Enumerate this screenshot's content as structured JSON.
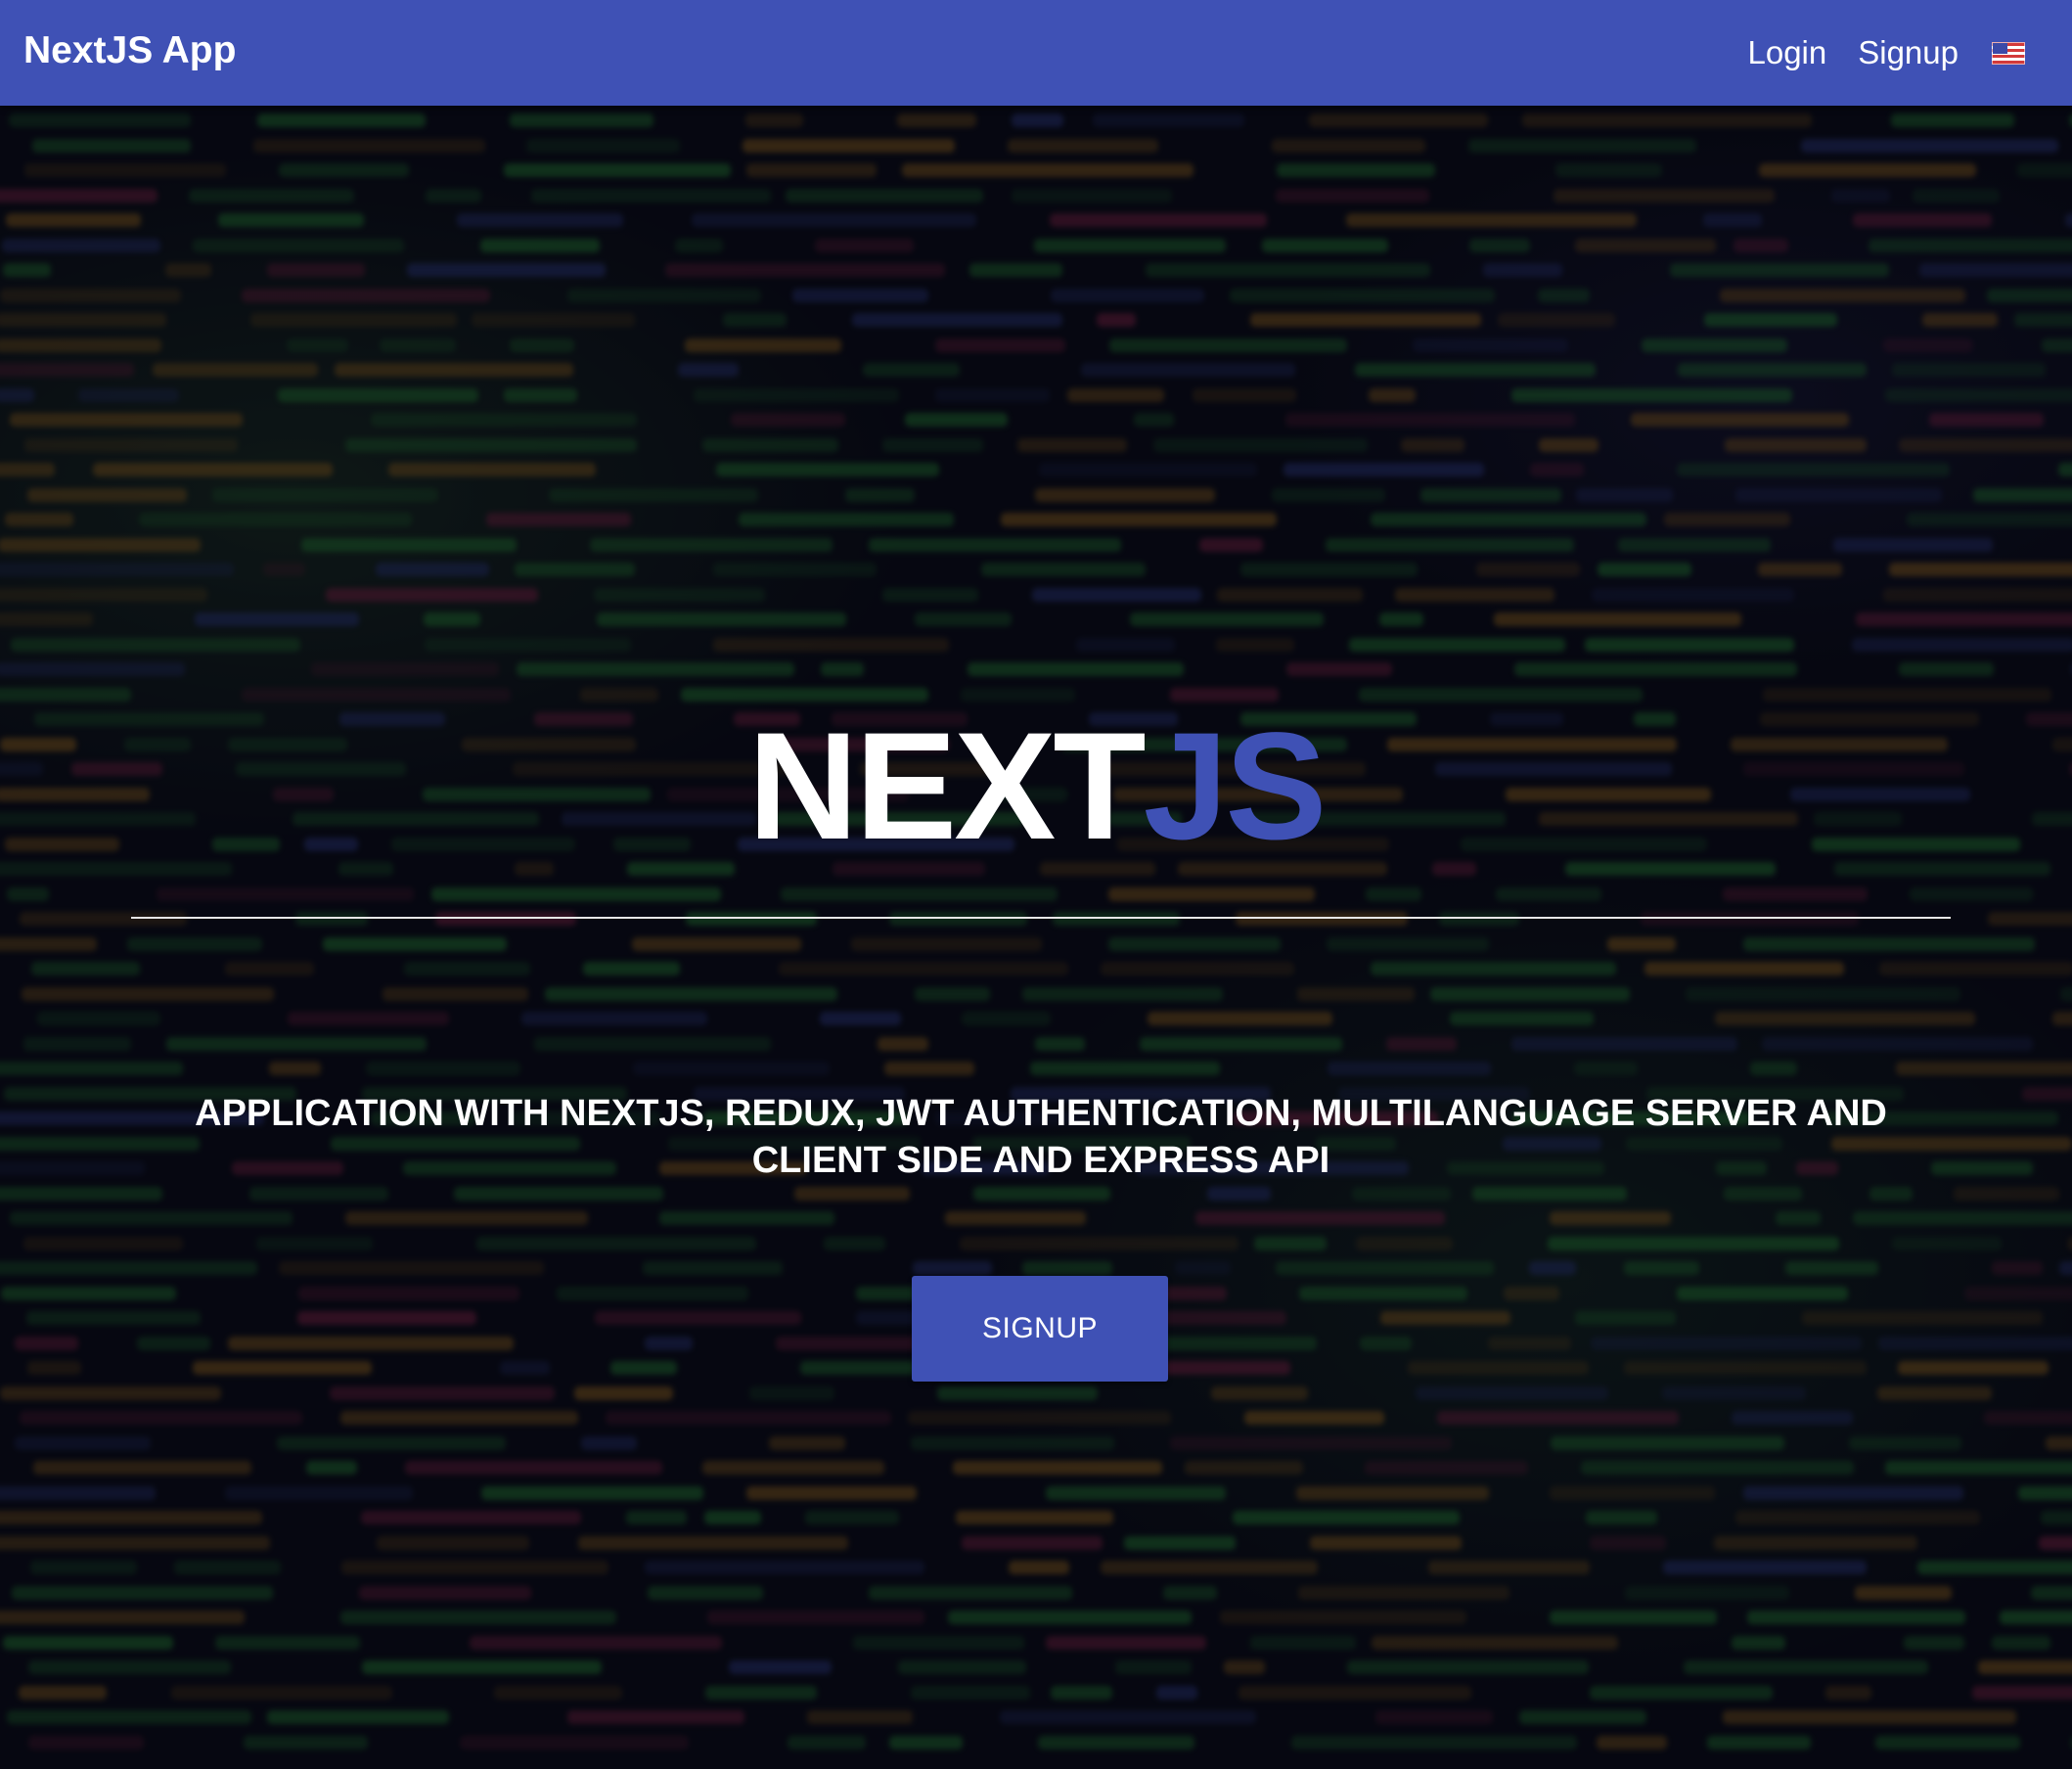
{
  "navbar": {
    "brand": "NextJS App",
    "links": {
      "login": "Login",
      "signup": "Signup"
    },
    "language_icon": "us-flag-icon",
    "background_color": "#3f51b5"
  },
  "hero": {
    "title_main": "NEXT",
    "title_accent": "JS",
    "subtitle": "APPLICATION WITH NEXTJS, REDUX, JWT AUTHENTICATION, MULTILANGUAGE SERVER AND CLIENT SIDE AND EXPRESS API",
    "cta_label": "SIGNUP",
    "accent_color": "#3f51b5"
  }
}
